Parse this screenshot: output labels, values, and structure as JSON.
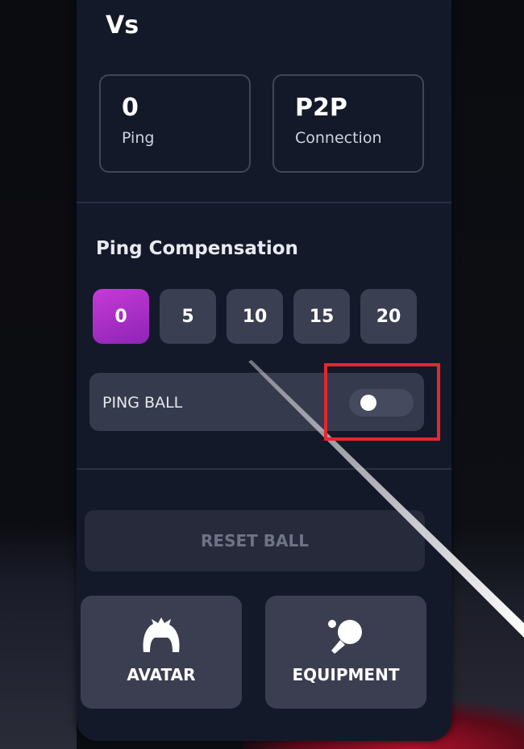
{
  "header": {
    "title": "Vs"
  },
  "stats": [
    {
      "value": "0",
      "label": "Ping"
    },
    {
      "value": "P2P",
      "label": "Connection"
    }
  ],
  "ping_compensation": {
    "title": "Ping Compensation",
    "options": [
      "0",
      "5",
      "10",
      "15",
      "20"
    ],
    "selected": "0"
  },
  "ping_ball": {
    "label": "PING BALL",
    "enabled": false
  },
  "reset_button": {
    "label": "RESET BALL",
    "disabled": true
  },
  "bottom_buttons": [
    {
      "label": "AVATAR",
      "icon": "hair-icon"
    },
    {
      "label": "EQUIPMENT",
      "icon": "ping-pong-paddle-icon"
    }
  ],
  "colors": {
    "panel_bg": "#14192a",
    "accent": "#b130c8",
    "highlight": "#e8262d"
  }
}
